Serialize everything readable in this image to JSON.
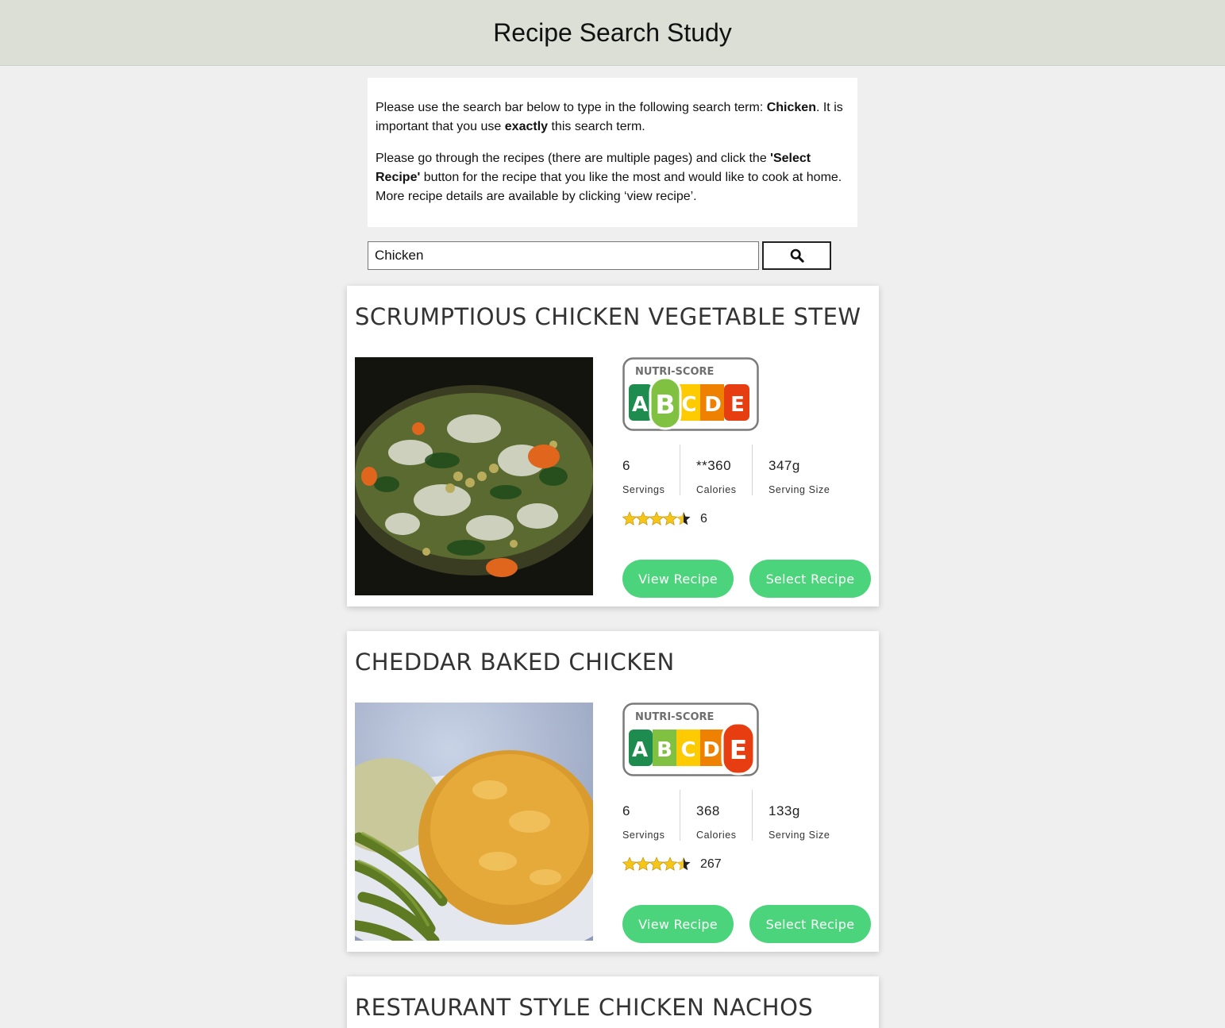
{
  "header": {
    "title": "Recipe Search Study"
  },
  "instructions": {
    "p1_a": "Please use the search bar below to type in the following search term: ",
    "p1_term": "Chicken",
    "p1_b": ". It is important that you use ",
    "p1_exactly": "exactly",
    "p1_c": " this search term.",
    "p2_a": "Please go through the recipes (there are multiple pages) and click the ",
    "p2_btn": "'Select Recipe'",
    "p2_b": " button for the recipe that you like the most and would like to cook at home. More recipe details are available by clicking ‘view recipe’."
  },
  "search": {
    "value": "Chicken",
    "icon": "search-icon"
  },
  "nutri_label": "NUTRI-SCORE",
  "nutri_letters": [
    "A",
    "B",
    "C",
    "D",
    "E"
  ],
  "colors": {
    "A": "#1e8c4e",
    "B": "#80c141",
    "C": "#fecb02",
    "D": "#ee8100",
    "E": "#e63e11",
    "button": "#4cd47c",
    "header": "#dcdfd5",
    "star": "#f5c518"
  },
  "labels": {
    "servings": "Servings",
    "calories": "Calories",
    "serving_size": "Serving Size",
    "view": "View Recipe",
    "select": "Select Recipe"
  },
  "recipes": [
    {
      "title": "SCRUMPTIOUS CHICKEN VEGETABLE STEW",
      "nutri_score": "B",
      "servings": "6",
      "calories": "**360",
      "serving_size": "347g",
      "rating_stars": 4.5,
      "rating_count": "6"
    },
    {
      "title": "CHEDDAR BAKED CHICKEN",
      "nutri_score": "E",
      "servings": "6",
      "calories": "368",
      "serving_size": "133g",
      "rating_stars": 4.5,
      "rating_count": "267"
    },
    {
      "title": "RESTAURANT STYLE CHICKEN NACHOS"
    }
  ]
}
